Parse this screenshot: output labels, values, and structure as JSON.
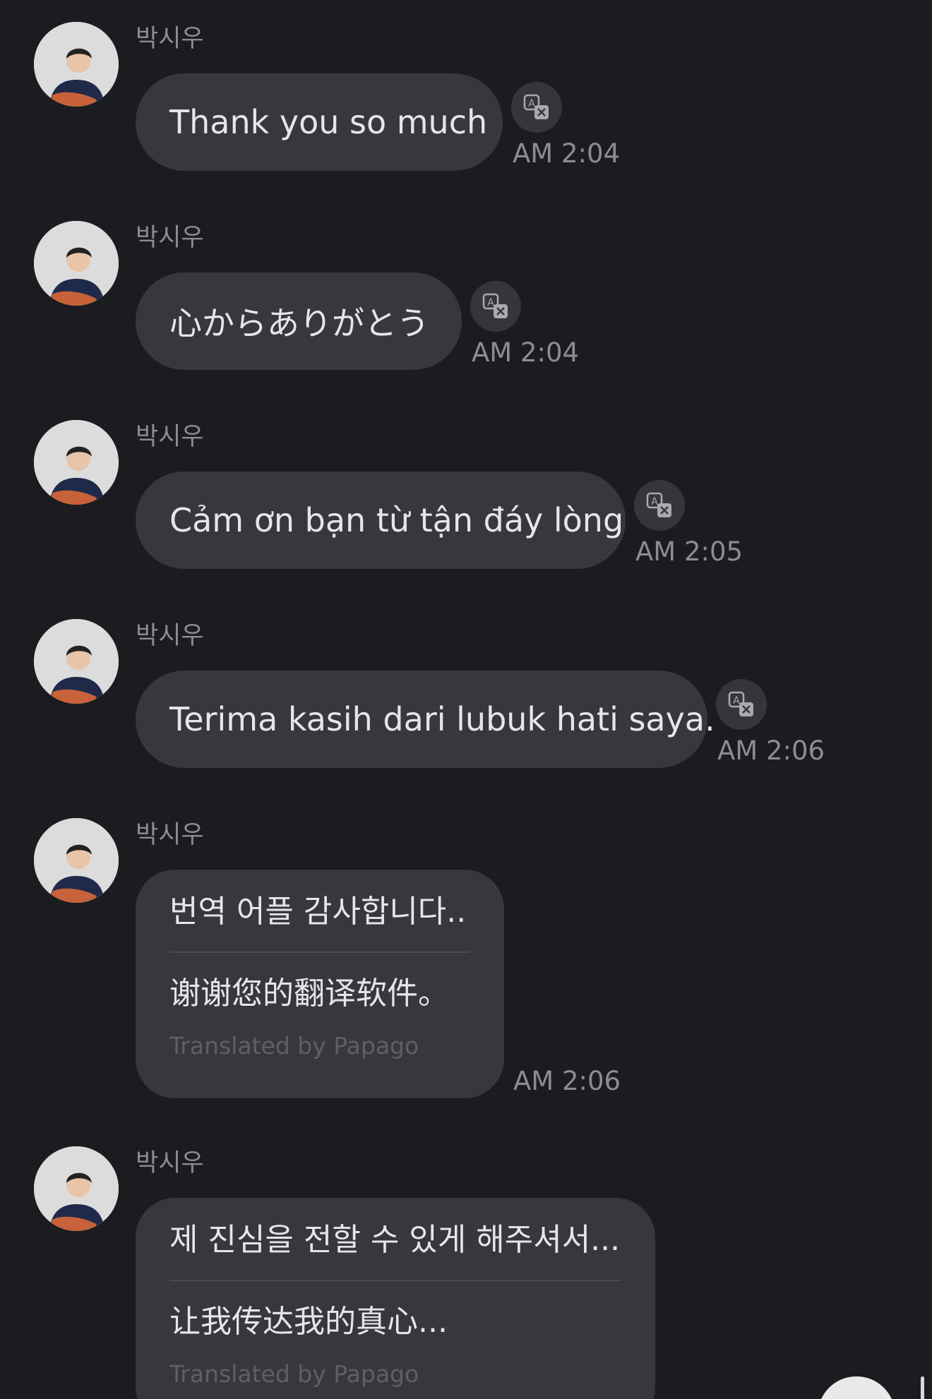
{
  "messages": [
    {
      "sender": "박시우",
      "text": "Thank you so much",
      "time": "AM 2:04"
    },
    {
      "sender": "박시우",
      "text": "心からありがとう",
      "time": "AM 2:04"
    },
    {
      "sender": "박시우",
      "text": "Cảm ơn bạn từ tận đáy lòng",
      "time": "AM 2:05"
    },
    {
      "sender": "박시우",
      "text": "Terima kasih dari lubuk hati saya.",
      "time": "AM 2:06"
    },
    {
      "sender": "박시우",
      "original": "번역 어플 감사합니다..",
      "translation": "谢谢您的翻译软件。",
      "translated_by": "Translated by Papago",
      "time": "AM 2:06"
    },
    {
      "sender": "박시우",
      "original": "제 진심을 전할 수 있게 해주셔서...",
      "translation": "让我传达我的真心...",
      "translated_by": "Translated by Papago"
    }
  ],
  "icons": {
    "avatar": "profile-photo",
    "translate": "translate-icon",
    "scroll_down": "scroll-down-button"
  },
  "colors": {
    "background": "#1b1c20",
    "bubble": "#37383d",
    "text": "#e6e6e8",
    "meta": "#8c8d92"
  }
}
